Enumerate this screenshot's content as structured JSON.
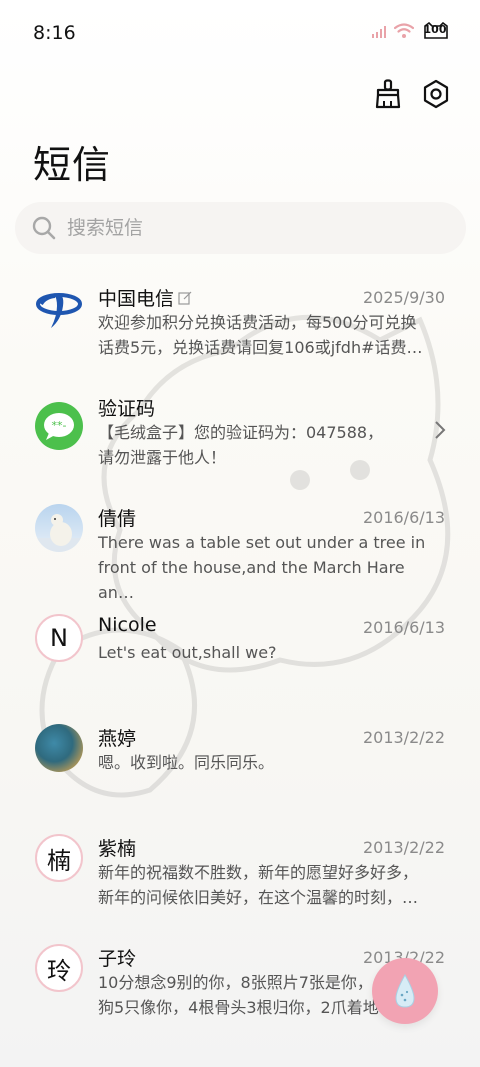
{
  "status": {
    "time": "8:16",
    "battery": "100"
  },
  "header": {
    "title": "短信",
    "clean_icon": "broom-icon",
    "settings_icon": "settings-hexagon-icon"
  },
  "search": {
    "placeholder": "搜索短信"
  },
  "messages": [
    {
      "name": "中国电信",
      "date": "2025/9/30",
      "line1": "欢迎参加积分兑换话费活动，每500分可兑换",
      "line2": "话费5元，兑换话费请回复106或jfdh#话费…",
      "avatar": "china-telecom-logo"
    },
    {
      "name": "验证码",
      "date": "",
      "line1": "【毛绒盒子】您的验证码为：047588，",
      "line2": "请勿泄露于他人！",
      "avatar": "message-bubble-icon"
    },
    {
      "name": "倩倩",
      "date": "2016/6/13",
      "line1": "There was a table set out under a tree in",
      "line2": "front of the house,and the March Hare an…",
      "avatar": "polar-bear-photo"
    },
    {
      "name": "Nicole",
      "date": "2016/6/13",
      "line1": "Let's eat out,shall we?",
      "line2": "",
      "avatar_letter": "N"
    },
    {
      "name": "燕婷",
      "date": "2013/2/22",
      "line1": "嗯。收到啦。同乐同乐。",
      "line2": "",
      "avatar": "landscape-photo"
    },
    {
      "name": "紫楠",
      "date": "2013/2/22",
      "line1": "新年的祝福数不胜数，新年的愿望好多好多，",
      "line2": "新年的问候依旧美好，在这个温馨的时刻，…",
      "avatar_letter": "楠"
    },
    {
      "name": "子玲",
      "date": "2013/2/22",
      "line1": "10分想念9别的你，8张照片7张是你，6只小",
      "line2": "狗5只像你，4根骨头3根归你，2爪着地1定…",
      "avatar_letter": "玲"
    }
  ],
  "colors": {
    "accent": "#f2a3b3",
    "verify_green": "#4cc04c",
    "telecom_blue": "#1f56b0"
  }
}
